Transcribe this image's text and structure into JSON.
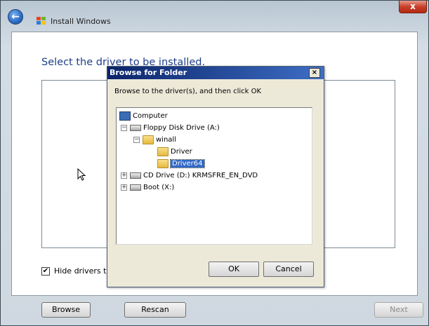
{
  "window": {
    "title": "Install Windows",
    "close_label": "x",
    "back_label": "←"
  },
  "main": {
    "heading": "Select the driver to be installed.",
    "hide_checkbox": {
      "checked": true,
      "mark": "✔",
      "label": "Hide drivers th"
    }
  },
  "buttons": {
    "browse": "Browse",
    "rescan": "Rescan",
    "next": "Next"
  },
  "dialog": {
    "title": "Browse for Folder",
    "close_label": "×",
    "instruction": "Browse to the driver(s), and then click OK",
    "tree": [
      {
        "label": "Computer",
        "icon": "computer-icon",
        "expander": ""
      },
      {
        "label": "Floppy Disk Drive (A:)",
        "icon": "floppy-drive-icon",
        "expander": "−"
      },
      {
        "label": "winall",
        "icon": "folder-icon",
        "expander": "−"
      },
      {
        "label": "Driver",
        "icon": "folder-icon",
        "expander": ""
      },
      {
        "label": "Driver64",
        "icon": "folder-icon",
        "expander": "",
        "selected": true
      },
      {
        "label": "CD Drive (D:) KRMSFRE_EN_DVD",
        "icon": "cd-drive-icon",
        "expander": "+"
      },
      {
        "label": "Boot (X:)",
        "icon": "drive-icon",
        "expander": "+"
      }
    ],
    "ok": "OK",
    "cancel": "Cancel"
  },
  "colors": {
    "heading": "#1e3d8a",
    "dialog_title_start": "#0a246a",
    "dialog_title_end": "#3e6ec4",
    "selection": "#3169c6"
  }
}
